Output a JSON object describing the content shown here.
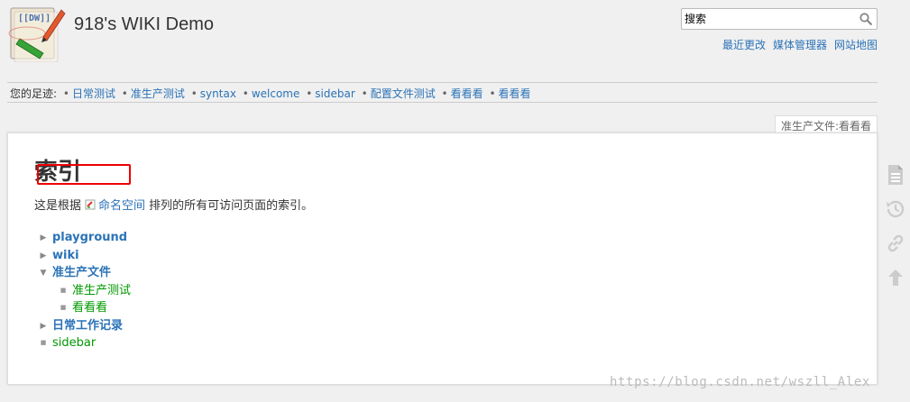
{
  "header": {
    "site_title": "918's WIKI Demo",
    "search_placeholder": "搜索",
    "site_tools": [
      "最近更改",
      "媒体管理器",
      "网站地图"
    ]
  },
  "breadcrumbs": {
    "label": "您的足迹:",
    "items": [
      "日常测试",
      "准生产测试",
      "syntax",
      "welcome",
      "sidebar",
      "配置文件测试",
      "看看看",
      "看看看"
    ]
  },
  "page_id": "准生产文件:看看看",
  "content": {
    "heading": "索引",
    "intro_before": "这是根据",
    "intro_link": "命名空间",
    "intro_after": "排列的所有可访问页面的索引。",
    "tree": [
      {
        "label": "playground",
        "type": "namespace",
        "state": "closed"
      },
      {
        "label": "wiki",
        "type": "namespace",
        "state": "closed"
      },
      {
        "label": "准生产文件",
        "type": "namespace",
        "state": "open",
        "children": [
          {
            "label": "准生产测试",
            "type": "page"
          },
          {
            "label": "看看看",
            "type": "page"
          }
        ]
      },
      {
        "label": "日常工作记录",
        "type": "namespace",
        "state": "closed"
      },
      {
        "label": "sidebar",
        "type": "page"
      }
    ]
  },
  "page_tools": [
    "file-text-icon",
    "history-icon",
    "link-icon",
    "arrow-up-icon"
  ],
  "watermark": "https://blog.csdn.net/wszll_Alex",
  "colors": {
    "link": "#2b73b7",
    "page_link": "#009900",
    "highlight": "#ee0000"
  }
}
